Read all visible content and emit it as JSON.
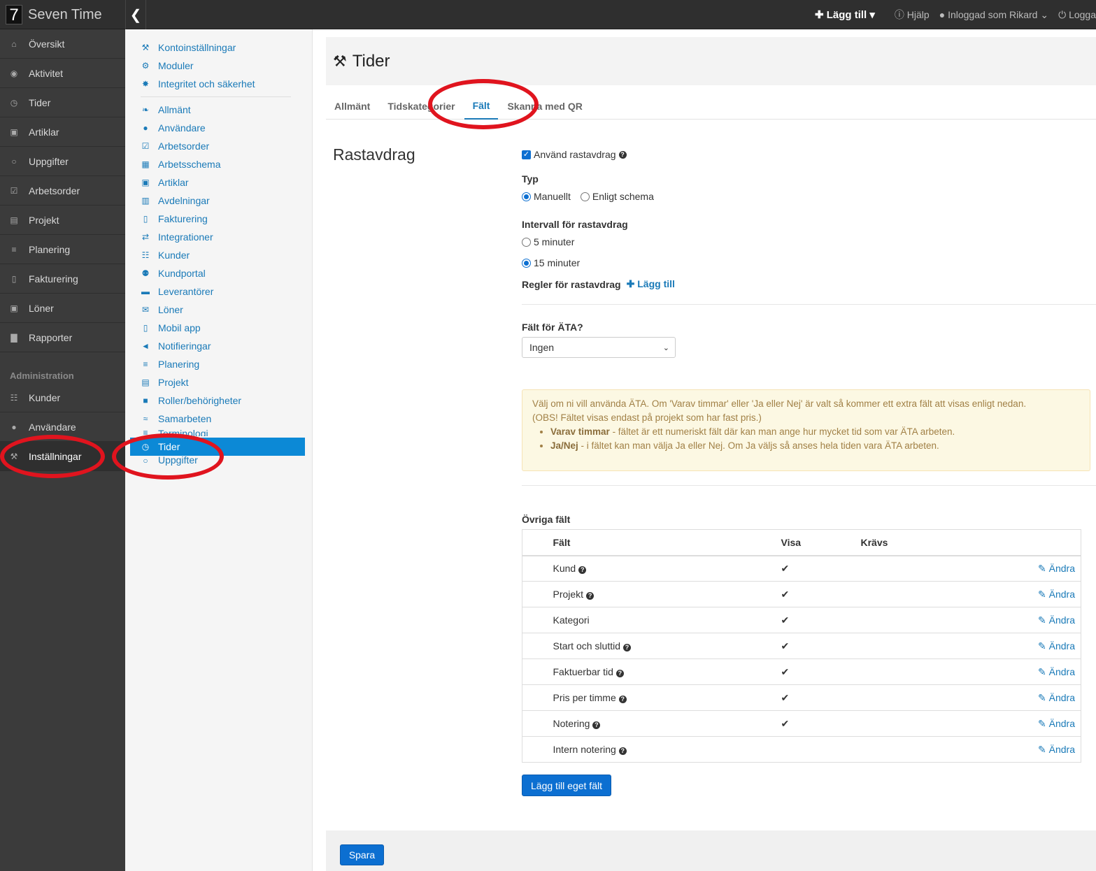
{
  "brand": {
    "logo": "7",
    "name": "Seven Time"
  },
  "topbar": {
    "add_label": "Lägg till",
    "help": "Hjälp",
    "user": "Inloggad som Rikard",
    "logout": "Logga"
  },
  "sidebar": {
    "items": [
      {
        "label": "Översikt",
        "icon": "home-icon"
      },
      {
        "label": "Aktivitet",
        "icon": "map-marker-icon"
      },
      {
        "label": "Tider",
        "icon": "clock-icon"
      },
      {
        "label": "Artiklar",
        "icon": "money-icon"
      },
      {
        "label": "Uppgifter",
        "icon": "circle-icon"
      },
      {
        "label": "Arbetsorder",
        "icon": "check-square-icon"
      },
      {
        "label": "Projekt",
        "icon": "briefcase-icon"
      },
      {
        "label": "Planering",
        "icon": "list-icon"
      },
      {
        "label": "Fakturering",
        "icon": "file-icon"
      },
      {
        "label": "Löner",
        "icon": "money-icon"
      },
      {
        "label": "Rapporter",
        "icon": "bar-chart-icon"
      }
    ],
    "admin_heading": "Administration",
    "admin_items": [
      {
        "label": "Kunder",
        "icon": "sitemap-icon"
      },
      {
        "label": "Användare",
        "icon": "user-icon"
      },
      {
        "label": "Inställningar",
        "icon": "wrench-icon"
      }
    ]
  },
  "subnav": {
    "top": [
      "Kontoinställningar",
      "Moduler",
      "Integritet och säkerhet"
    ],
    "items": [
      "Allmänt",
      "Användare",
      "Arbetsorder",
      "Arbetsschema",
      "Artiklar",
      "Avdelningar",
      "Fakturering",
      "Integrationer",
      "Kunder",
      "Kundportal",
      "Leverantörer",
      "Löner",
      "Mobil app",
      "Notifieringar",
      "Planering",
      "Projekt",
      "Roller/behörigheter",
      "Samarbeten",
      "Terminologi",
      "Tider",
      "Uppgifter"
    ]
  },
  "page": {
    "title": "Tider",
    "tabs": [
      "Allmänt",
      "Tidskategorier",
      "Fält",
      "Skanna med QR"
    ],
    "section_title": "Rastavdrag",
    "use_break": "Använd rastavdrag",
    "type_label": "Typ",
    "type_manual": "Manuellt",
    "type_schedule": "Enligt schema",
    "interval_label": "Intervall för rastavdrag",
    "interval_5": "5 minuter",
    "interval_15": "15 minuter",
    "rules_label": "Regler för rastavdrag",
    "rules_add": "Lägg till",
    "ata_label": "Fält för ÄTA?",
    "ata_value": "Ingen",
    "note_line1": "Välj om ni vill använda ÄTA. Om 'Varav timmar' eller 'Ja eller Nej' är valt så kommer ett extra fält att visas enligt nedan.",
    "note_line2": "(OBS! Fältet visas endast på projekt som har fast pris.)",
    "note_b1_bold": "Varav timmar",
    "note_b1_text": " - fältet är ett numeriskt fält där kan man ange hur mycket tid som var ÄTA arbeten.",
    "note_b2_bold": "Ja/Nej",
    "note_b2_text": " - i fältet kan man välja Ja eller Nej. Om Ja väljs så anses hela tiden vara ÄTA arbeten.",
    "other_fields": "Övriga fält",
    "col_field": "Fält",
    "col_show": "Visa",
    "col_required": "Krävs",
    "edit_label": "Ändra",
    "rows": [
      {
        "name": "Kund",
        "help": true,
        "show": true
      },
      {
        "name": "Projekt",
        "help": true,
        "show": true
      },
      {
        "name": "Kategori",
        "help": false,
        "show": true
      },
      {
        "name": "Start och sluttid",
        "help": true,
        "show": true
      },
      {
        "name": "Faktuerbar tid",
        "help": true,
        "show": true
      },
      {
        "name": "Pris per timme",
        "help": true,
        "show": true
      },
      {
        "name": "Notering",
        "help": true,
        "show": true
      },
      {
        "name": "Intern notering",
        "help": true,
        "show": false
      }
    ],
    "add_custom": "Lägg till eget fält",
    "save": "Spara"
  },
  "colors": {
    "accent": "#1a7ab8",
    "primary": "#0c6fd1",
    "active_nav": "#0c89d6",
    "annotation": "#e0141e"
  }
}
